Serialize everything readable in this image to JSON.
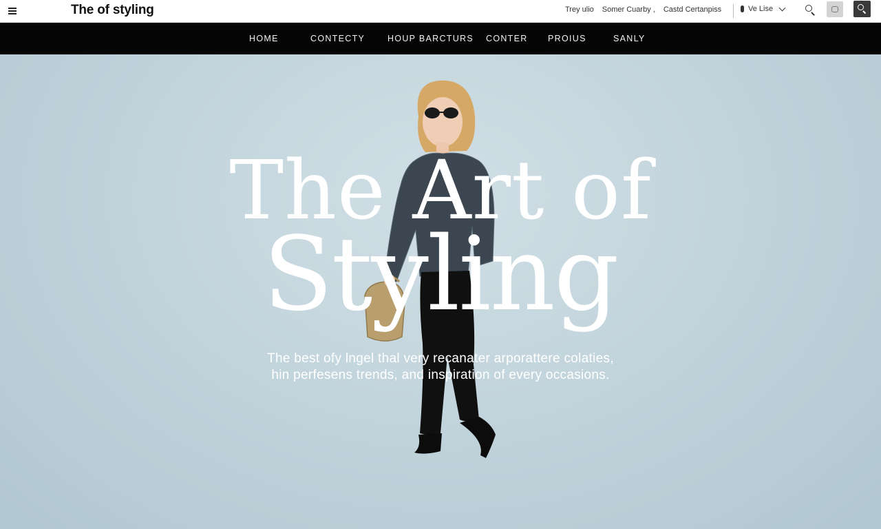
{
  "header": {
    "brand": "The of styling",
    "utility_links": [
      "Trey ulio",
      "Somer Cuarby ,",
      "Castd Certanpiss"
    ],
    "language": "Ve Lise"
  },
  "nav": {
    "items": [
      "HOME",
      "CONTECTY",
      "HOUP BARCTURS",
      "CONTER",
      "PROIUS",
      "SANLY"
    ]
  },
  "hero": {
    "title_line1": "The Art of",
    "title_line2": "Styling",
    "subtitle_line1": "The best ofy lngel thal very recanater arporattere colaties,",
    "subtitle_line2": "hin perfesens trends, and inspiration of every occasions."
  },
  "colors": {
    "topbar_bg": "#ffffff",
    "navbar_bg": "#050505",
    "hero_bg": "#c2d3db",
    "hero_text": "#ffffff"
  },
  "icons": [
    "menu-icon",
    "language-dot-icon",
    "chevron-down-icon",
    "search-icon",
    "bookmark-icon",
    "search-button-icon"
  ]
}
